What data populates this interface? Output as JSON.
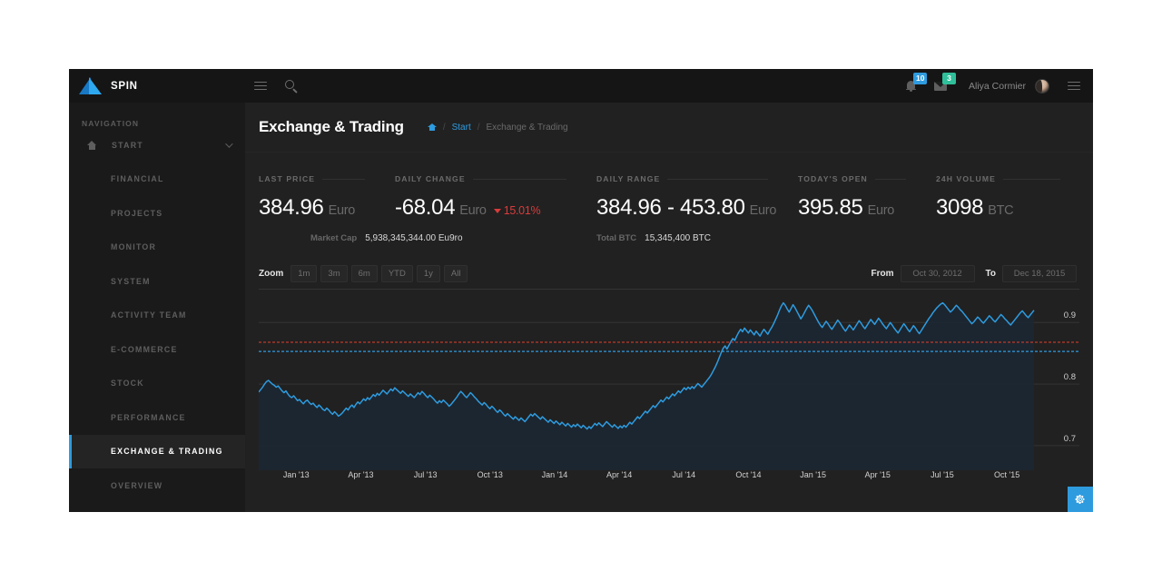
{
  "brand": {
    "name": "SPIN",
    "logo_icon": "triangle-logo"
  },
  "topbar": {
    "menu_icon": "hamburger-icon",
    "search_icon": "search-icon",
    "notifications": {
      "icon": "bell-icon",
      "count": "10",
      "color": "#2e9bdf"
    },
    "messages": {
      "icon": "envelope-icon",
      "count": "3",
      "color": "#2fbf9a"
    },
    "username": "Aliya Cormier",
    "avatar_icon": "avatar",
    "right_menu_icon": "hamburger-icon"
  },
  "sidebar": {
    "heading": "NAVIGATION",
    "group": {
      "label": "START",
      "icon": "home-icon",
      "chevron": "chevron-down-icon"
    },
    "items": [
      {
        "label": "FINANCIAL",
        "active": false
      },
      {
        "label": "PROJECTS",
        "active": false
      },
      {
        "label": "MONITOR",
        "active": false
      },
      {
        "label": "SYSTEM",
        "active": false
      },
      {
        "label": "ACTIVITY TEAM",
        "active": false
      },
      {
        "label": "E-COMMERCE",
        "active": false
      },
      {
        "label": "STOCK",
        "active": false
      },
      {
        "label": "PERFORMANCE",
        "active": false
      },
      {
        "label": "EXCHANGE & TRADING",
        "active": true
      },
      {
        "label": "OVERVIEW",
        "active": false
      }
    ]
  },
  "page": {
    "title": "Exchange & Trading",
    "breadcrumb": {
      "home_icon": "home-icon",
      "sep1": "/",
      "link": "Start",
      "sep2": "/",
      "current": "Exchange & Trading"
    }
  },
  "stats": [
    {
      "label": "LAST PRICE",
      "value": "384.96",
      "unit": "Euro"
    },
    {
      "label": "DAILY CHANGE",
      "value": "-68.04",
      "unit": "Euro",
      "pct": "15.01%",
      "direction_icon": "caret-down-icon"
    },
    {
      "label": "DAILY RANGE",
      "value": "384.96 - 453.80",
      "unit": "Euro"
    },
    {
      "label": "TODAY'S OPEN",
      "value": "395.85",
      "unit": "Euro"
    },
    {
      "label": "24H VOLUME",
      "value": "3098",
      "unit": "BTC"
    }
  ],
  "substats": [
    {
      "label": "Market Cap",
      "value": "5,938,345,344.00 Eu9ro"
    },
    {
      "label": "Total BTC",
      "value": "15,345,400 BTC"
    }
  ],
  "chart_toolbar": {
    "zoom_label": "Zoom",
    "zoom_options": [
      "1m",
      "3m",
      "6m",
      "YTD",
      "1y",
      "All"
    ],
    "from_label": "From",
    "from_value": "Oct 30, 2012",
    "to_label": "To",
    "to_value": "Dec 18, 2015"
  },
  "fab": {
    "icon": "gear-icon",
    "color": "#2e9bdf"
  },
  "chart_data": {
    "type": "line",
    "title": "",
    "xlabel": "",
    "ylabel": "",
    "grid": true,
    "legend": "none",
    "line_color": "#2e9bdf",
    "fill_color": "#1b2733",
    "ylim": [
      0.66,
      0.955
    ],
    "yticks": [
      0.7,
      0.8,
      0.9
    ],
    "ytick_labels": [
      "0.7",
      "0.8",
      "0.9"
    ],
    "yaxis_position": "right",
    "reference_lines": [
      {
        "value": 0.868,
        "color": "#c0392b",
        "style": "dashed"
      },
      {
        "value": 0.853,
        "color": "#2e9bdf",
        "style": "dashed"
      }
    ],
    "xtick_labels": [
      "Jan '13",
      "Apr '13",
      "Jul '13",
      "Oct '13",
      "Jan '14",
      "Apr '14",
      "Jul '14",
      "Oct '14",
      "Jan '15",
      "Apr '15",
      "Jul '15",
      "Oct '15"
    ],
    "x_range": [
      "Oct 30, 2012",
      "Dec 18, 2015"
    ],
    "values": [
      0.787,
      0.791,
      0.795,
      0.8,
      0.804,
      0.806,
      0.803,
      0.8,
      0.798,
      0.795,
      0.797,
      0.793,
      0.789,
      0.786,
      0.789,
      0.784,
      0.78,
      0.778,
      0.781,
      0.777,
      0.773,
      0.775,
      0.771,
      0.768,
      0.772,
      0.774,
      0.77,
      0.767,
      0.769,
      0.765,
      0.762,
      0.766,
      0.763,
      0.759,
      0.757,
      0.761,
      0.758,
      0.754,
      0.751,
      0.755,
      0.752,
      0.748,
      0.75,
      0.753,
      0.757,
      0.761,
      0.758,
      0.763,
      0.766,
      0.762,
      0.767,
      0.771,
      0.768,
      0.772,
      0.776,
      0.773,
      0.778,
      0.775,
      0.779,
      0.783,
      0.78,
      0.785,
      0.782,
      0.786,
      0.79,
      0.787,
      0.784,
      0.788,
      0.792,
      0.789,
      0.794,
      0.791,
      0.788,
      0.785,
      0.789,
      0.786,
      0.783,
      0.78,
      0.784,
      0.781,
      0.778,
      0.782,
      0.786,
      0.783,
      0.788,
      0.785,
      0.781,
      0.778,
      0.782,
      0.779,
      0.776,
      0.772,
      0.769,
      0.773,
      0.77,
      0.774,
      0.771,
      0.768,
      0.764,
      0.767,
      0.771,
      0.775,
      0.779,
      0.784,
      0.788,
      0.785,
      0.781,
      0.778,
      0.782,
      0.786,
      0.783,
      0.779,
      0.776,
      0.772,
      0.769,
      0.766,
      0.77,
      0.767,
      0.763,
      0.76,
      0.764,
      0.761,
      0.757,
      0.754,
      0.758,
      0.755,
      0.751,
      0.748,
      0.752,
      0.749,
      0.746,
      0.743,
      0.747,
      0.744,
      0.741,
      0.745,
      0.742,
      0.739,
      0.743,
      0.747,
      0.751,
      0.748,
      0.752,
      0.749,
      0.746,
      0.743,
      0.747,
      0.744,
      0.741,
      0.738,
      0.742,
      0.739,
      0.736,
      0.74,
      0.737,
      0.734,
      0.738,
      0.735,
      0.732,
      0.736,
      0.733,
      0.73,
      0.734,
      0.731,
      0.735,
      0.732,
      0.729,
      0.733,
      0.73,
      0.727,
      0.731,
      0.728,
      0.732,
      0.736,
      0.733,
      0.737,
      0.734,
      0.731,
      0.735,
      0.739,
      0.736,
      0.733,
      0.73,
      0.734,
      0.731,
      0.728,
      0.732,
      0.729,
      0.733,
      0.73,
      0.734,
      0.738,
      0.735,
      0.739,
      0.743,
      0.747,
      0.744,
      0.748,
      0.752,
      0.756,
      0.753,
      0.757,
      0.761,
      0.765,
      0.762,
      0.766,
      0.77,
      0.774,
      0.771,
      0.775,
      0.779,
      0.776,
      0.78,
      0.784,
      0.781,
      0.785,
      0.789,
      0.786,
      0.79,
      0.794,
      0.791,
      0.795,
      0.792,
      0.796,
      0.793,
      0.797,
      0.801,
      0.798,
      0.795,
      0.799,
      0.803,
      0.807,
      0.811,
      0.816,
      0.822,
      0.828,
      0.835,
      0.843,
      0.851,
      0.858,
      0.862,
      0.857,
      0.863,
      0.869,
      0.874,
      0.871,
      0.878,
      0.884,
      0.889,
      0.885,
      0.891,
      0.887,
      0.883,
      0.888,
      0.884,
      0.88,
      0.886,
      0.882,
      0.878,
      0.884,
      0.889,
      0.885,
      0.881,
      0.887,
      0.892,
      0.898,
      0.905,
      0.912,
      0.92,
      0.927,
      0.932,
      0.928,
      0.922,
      0.917,
      0.923,
      0.929,
      0.924,
      0.918,
      0.912,
      0.906,
      0.911,
      0.917,
      0.923,
      0.928,
      0.924,
      0.919,
      0.913,
      0.907,
      0.901,
      0.896,
      0.892,
      0.897,
      0.902,
      0.898,
      0.893,
      0.889,
      0.894,
      0.899,
      0.904,
      0.9,
      0.895,
      0.89,
      0.886,
      0.891,
      0.896,
      0.892,
      0.888,
      0.893,
      0.898,
      0.903,
      0.899,
      0.894,
      0.89,
      0.895,
      0.9,
      0.905,
      0.901,
      0.897,
      0.902,
      0.907,
      0.903,
      0.898,
      0.894,
      0.89,
      0.895,
      0.9,
      0.896,
      0.891,
      0.887,
      0.883,
      0.888,
      0.893,
      0.898,
      0.894,
      0.889,
      0.885,
      0.89,
      0.895,
      0.891,
      0.886,
      0.882,
      0.887,
      0.892,
      0.897,
      0.902,
      0.907,
      0.911,
      0.916,
      0.92,
      0.924,
      0.927,
      0.93,
      0.932,
      0.929,
      0.925,
      0.921,
      0.917,
      0.92,
      0.924,
      0.928,
      0.925,
      0.921,
      0.918,
      0.914,
      0.91,
      0.906,
      0.902,
      0.898,
      0.901,
      0.905,
      0.909,
      0.906,
      0.902,
      0.899,
      0.903,
      0.907,
      0.911,
      0.908,
      0.904,
      0.901,
      0.905,
      0.909,
      0.913,
      0.91,
      0.906,
      0.903,
      0.899,
      0.896,
      0.9,
      0.904,
      0.908,
      0.912,
      0.916,
      0.919,
      0.915,
      0.911,
      0.908,
      0.912,
      0.916,
      0.92
    ]
  }
}
